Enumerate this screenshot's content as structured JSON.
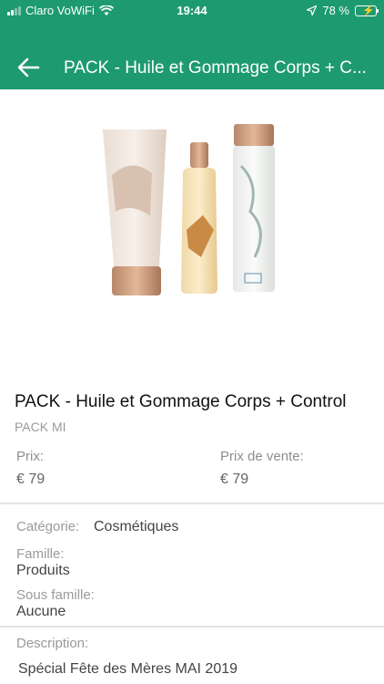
{
  "status_bar": {
    "carrier": "Claro VoWiFi",
    "time": "19:44",
    "battery": "78 %",
    "battery_level": 0.78
  },
  "app_bar": {
    "title": "PACK - Huile et Gommage Corps + C..."
  },
  "product": {
    "name": "PACK - Huile et Gommage Corps + Control",
    "code": "PACK MI",
    "price_label": "Prix:",
    "price_value": "€ 79",
    "sale_price_label": "Prix de vente:",
    "sale_price_value": "€ 79",
    "category_label": "Catégorie:",
    "category_value": "Cosmétiques",
    "family_label": "Famille:",
    "family_value": "Produits",
    "subfamily_label": "Sous famille:",
    "subfamily_value": "Aucune",
    "description_label": "Description:",
    "description_value": "Spécial Fête des Mères MAI 2019"
  },
  "colors": {
    "header": "#1e9a70"
  }
}
